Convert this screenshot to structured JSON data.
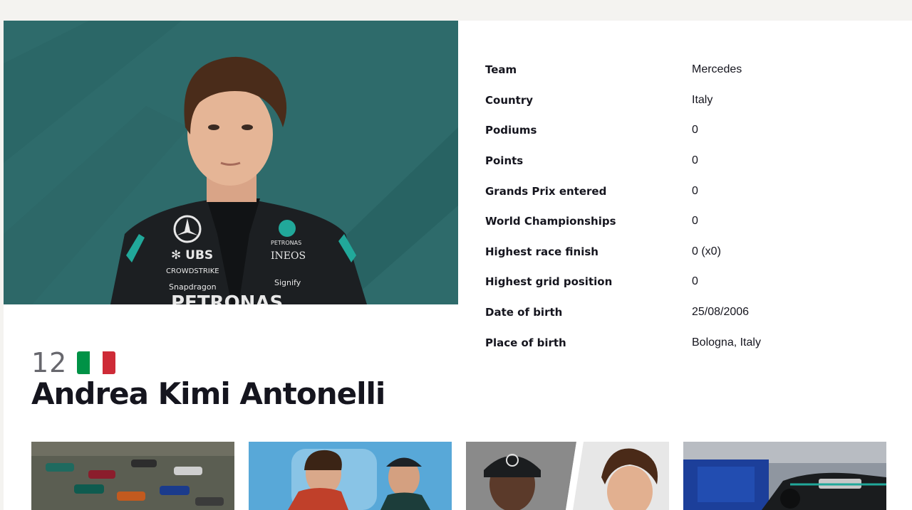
{
  "driver": {
    "number": "12",
    "name": "Andrea Kimi Antonelli",
    "flag_colors": [
      "#009246",
      "#ffffff",
      "#ce2b37"
    ]
  },
  "stats": [
    {
      "label": "Team",
      "value": "Mercedes"
    },
    {
      "label": "Country",
      "value": "Italy"
    },
    {
      "label": "Podiums",
      "value": "0"
    },
    {
      "label": "Points",
      "value": "0"
    },
    {
      "label": "Grands Prix entered",
      "value": "0"
    },
    {
      "label": "World Championships",
      "value": "0"
    },
    {
      "label": "Highest race finish",
      "value": "0 (x0)"
    },
    {
      "label": "Highest grid position",
      "value": "0"
    },
    {
      "label": "Date of birth",
      "value": "25/08/2006"
    },
    {
      "label": "Place of birth",
      "value": "Bologna, Italy"
    }
  ],
  "portrait": {
    "background": "#2e6b6b",
    "suit_sponsors": [
      "PETRONAS",
      "UBS",
      "INEOS",
      "CROWDSTRIKE",
      "Snapdragon",
      "Signify"
    ]
  },
  "colors": {
    "text": "#15151e",
    "number": "#67676d"
  }
}
